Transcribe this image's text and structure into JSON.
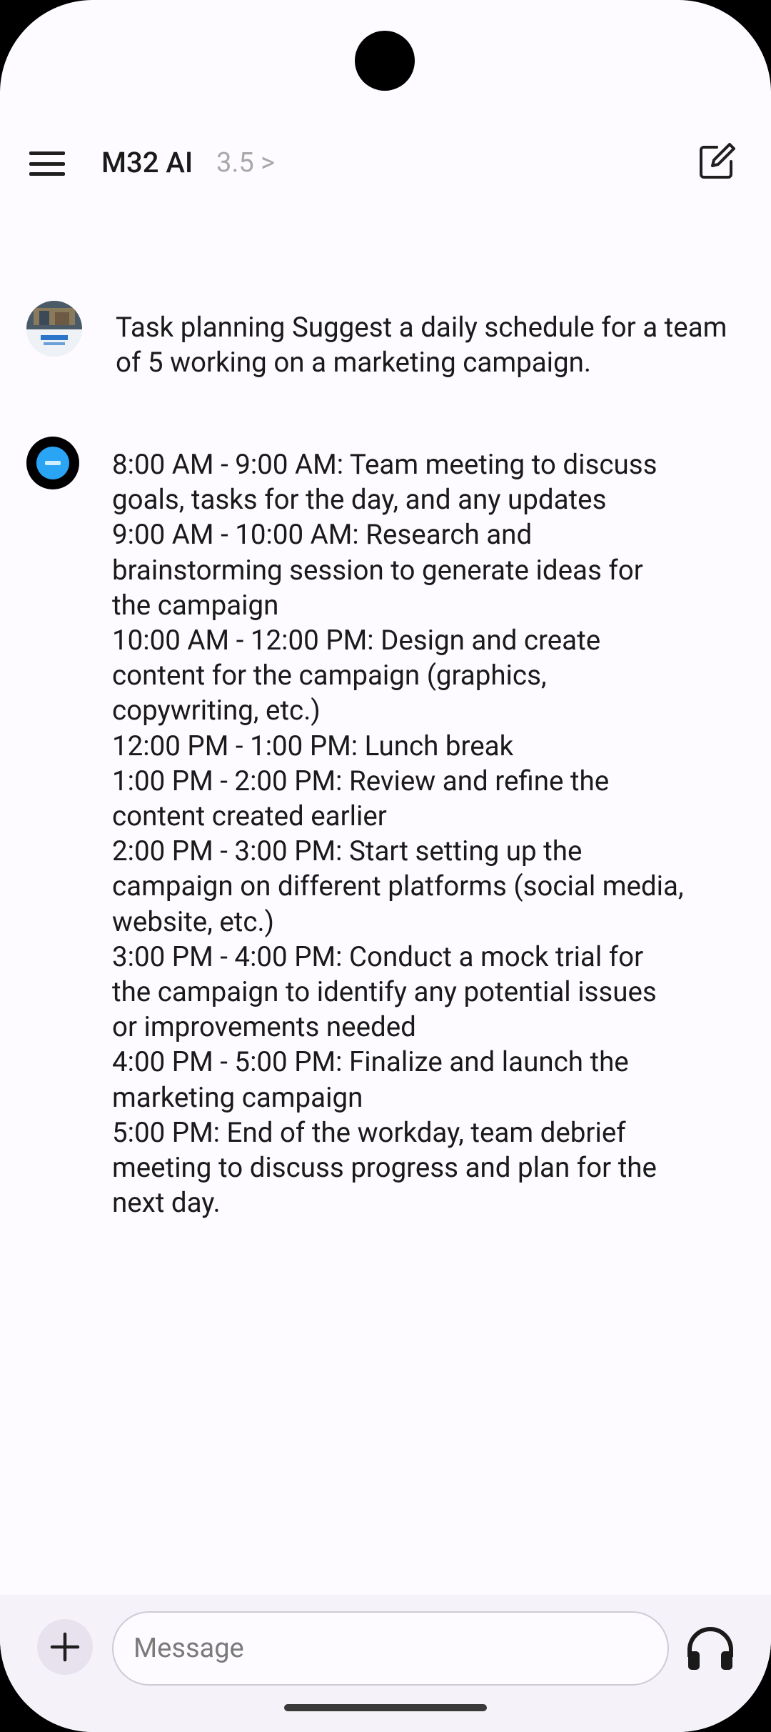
{
  "header": {
    "title": "M32 AI",
    "model_version": "3.5 >",
    "menu_icon": "hamburger-menu-icon",
    "new_chat_icon": "edit-square-icon"
  },
  "conversation": {
    "user_message": "Task planning Suggest a daily schedule for a team of 5 working on a marketing campaign.",
    "bot_lines": [
      "8:00 AM - 9:00 AM: Team meeting to discuss",
      "goals, tasks for the day, and any updates",
      "9:00 AM - 10:00 AM: Research and",
      "brainstorming session to generate ideas for",
      "the campaign",
      "10:00 AM - 12:00 PM: Design and create",
      "content for the campaign (graphics,",
      "copywriting, etc.)",
      "12:00 PM - 1:00 PM: Lunch break",
      "1:00 PM - 2:00 PM: Review and refine the",
      "content created earlier",
      "2:00 PM - 3:00 PM: Start setting up the",
      "campaign on different platforms (social media,",
      "website, etc.)",
      "3:00 PM - 4:00 PM: Conduct a mock trial for",
      "the campaign to identify any potential issues",
      "or improvements needed",
      "4:00 PM - 5:00 PM: Finalize and launch the",
      "marketing campaign",
      "5:00 PM: End of the workday, team debrief",
      "meeting to discuss progress and plan for the",
      "next day."
    ]
  },
  "composer": {
    "placeholder": "Message",
    "value": "",
    "add_icon": "plus-icon",
    "voice_icon": "headphones-icon"
  },
  "colors": {
    "background": "#fdfbff",
    "composer_bar": "#f6f2f9",
    "bot_avatar_accent": "#2aa4f4",
    "version_text": "#a8a8a8"
  }
}
